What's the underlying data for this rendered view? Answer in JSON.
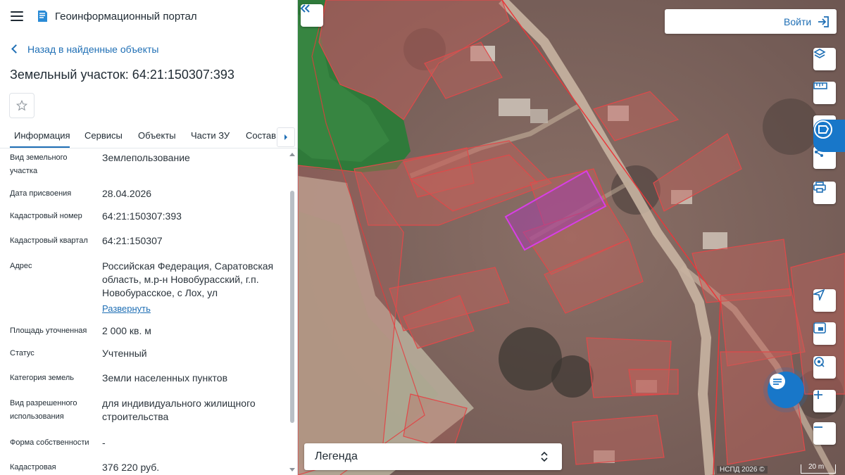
{
  "header": {
    "app_title": "Геоинформационный портал"
  },
  "nav": {
    "back_label": "Назад в найденные объекты"
  },
  "object": {
    "title": "Земельный участок: 64:21:150307:393"
  },
  "tabs": [
    {
      "label": "Информация",
      "active": true
    },
    {
      "label": "Сервисы"
    },
    {
      "label": "Объекты"
    },
    {
      "label": "Части ЗУ"
    },
    {
      "label": "Состав"
    }
  ],
  "properties": [
    {
      "label": "Вид земельного участка",
      "value": "Землепользование"
    },
    {
      "label": "Дата присвоения",
      "value": "28.04.2026"
    },
    {
      "label": "Кадастровый номер",
      "value": "64:21:150307:393"
    },
    {
      "label": "Кадастровый квартал",
      "value": "64:21:150307"
    },
    {
      "label": "Адрес",
      "value": "Российская Федерация, Саратовская область, м.р-н Новобурасский, г.п. Новобурасское, с Лох, ул",
      "expand_label": "Развернуть"
    },
    {
      "label": "Площадь уточненная",
      "value": "2 000 кв. м"
    },
    {
      "label": "Статус",
      "value": "Учтенный"
    },
    {
      "label": "Категория земель",
      "value": "Земли населенных пунктов"
    },
    {
      "label": "Вид разрешенного использования",
      "value": "для индивидуального жилищного строительства"
    },
    {
      "label": "Форма собственности",
      "value": "-"
    },
    {
      "label": "Кадастровая",
      "value": "376 220 руб."
    }
  ],
  "map": {
    "login_label": "Войти",
    "legend_label": "Легенда",
    "attribution": "НСПД 2026 ©",
    "scale_label": "20 m",
    "tools": [
      "collapse-panel-icon",
      "layers-icon",
      "ruler-icon",
      "share-icon",
      "print-icon",
      "navigate-icon",
      "minimap-icon",
      "geolocation-icon",
      "zoom-in-icon",
      "zoom-out-icon",
      "chat-icon"
    ],
    "colors": {
      "parcel_fill": "#c0615a",
      "parcel_stroke": "#e0494a",
      "selected_fill": "#a23fa8",
      "selected_stroke": "#d83ee6",
      "forest": "#2f7a3a",
      "accent": "#1877c9"
    }
  }
}
